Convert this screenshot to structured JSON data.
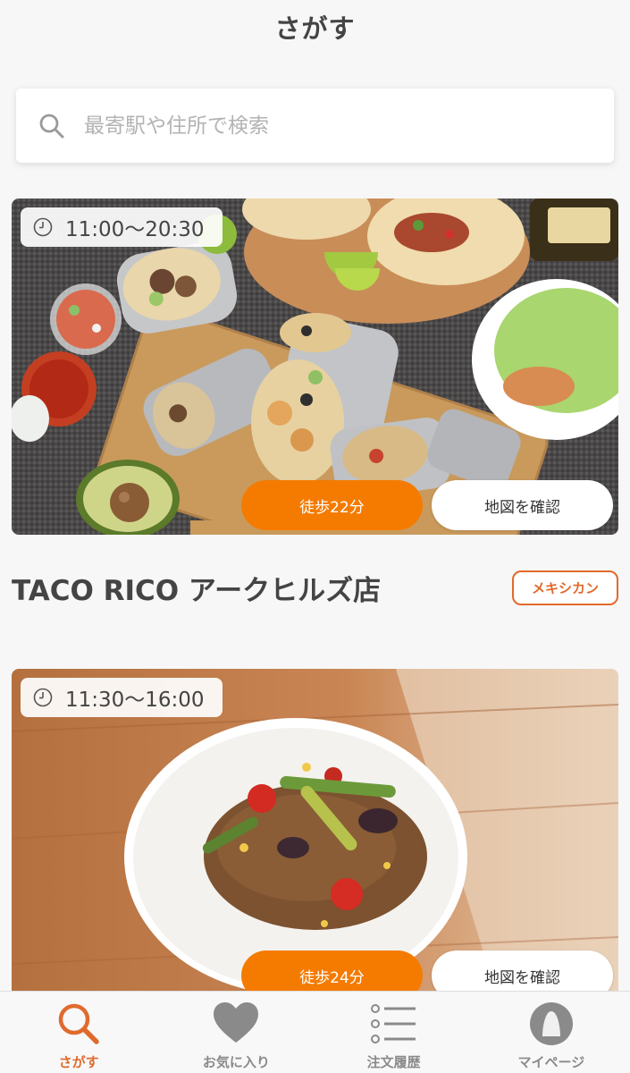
{
  "header": {
    "title": "さがす"
  },
  "search": {
    "placeholder": "最寄駅や住所で検索"
  },
  "cards": [
    {
      "hours": "11:00〜20:30",
      "walk": "徒歩22分",
      "map": "地図を確認",
      "name": "TACO RICO アークヒルズ店",
      "genre": "メキシカン"
    },
    {
      "hours": "11:30〜16:00",
      "walk": "徒歩24分",
      "map": "地図を確認"
    }
  ],
  "tabs": [
    {
      "label": "さがす",
      "icon": "search-icon",
      "active": true
    },
    {
      "label": "お気に入り",
      "icon": "heart-icon",
      "active": false
    },
    {
      "label": "注文履歴",
      "icon": "list-icon",
      "active": false
    },
    {
      "label": "マイページ",
      "icon": "person-icon",
      "active": false
    }
  ],
  "colors": {
    "accent": "#f47b00",
    "tag": "#e2692b",
    "active_tab": "#e06a2e"
  }
}
